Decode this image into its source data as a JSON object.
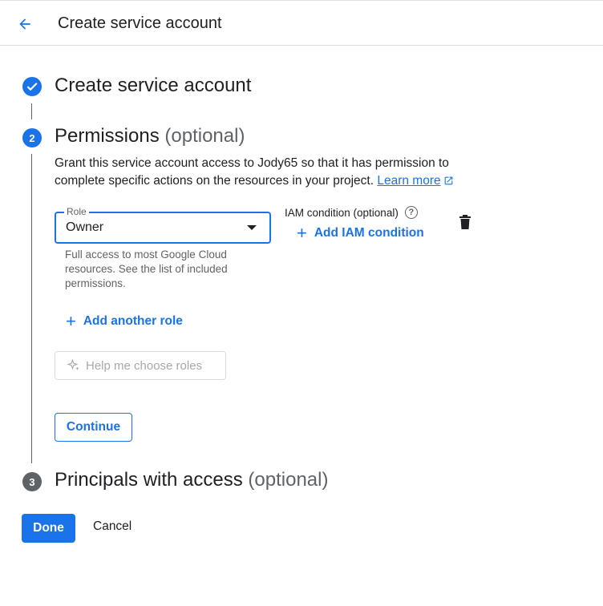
{
  "header": {
    "back_icon": "arrow-back-icon",
    "title": "Create service account"
  },
  "steps": [
    {
      "state": "done",
      "icon": "check-icon",
      "title": "Create service account",
      "optional": ""
    },
    {
      "state": "active",
      "number": "2",
      "title": "Permissions",
      "optional": "(optional)"
    },
    {
      "state": "pending",
      "number": "3",
      "title": "Principals with access",
      "optional": "(optional)"
    }
  ],
  "permissions": {
    "description": "Grant this service account access to Jody65 so that it has permission to complete specific actions on the resources in your project.",
    "learn_more": "Learn more",
    "role_label": "Role",
    "role_value": "Owner",
    "role_help": "Full access to most Google Cloud resources. See the list of included permissions.",
    "iam_condition_label": "IAM condition (optional)",
    "add_iam_condition": "Add IAM condition",
    "add_another_role": "Add another role",
    "help_choose_roles": "Help me choose roles",
    "continue": "Continue"
  },
  "footer": {
    "done": "Done",
    "cancel": "Cancel"
  },
  "colors": {
    "accent": "#1a73e8",
    "text": "#202124",
    "muted": "#5f6368",
    "disabled": "#a6a8ab"
  }
}
